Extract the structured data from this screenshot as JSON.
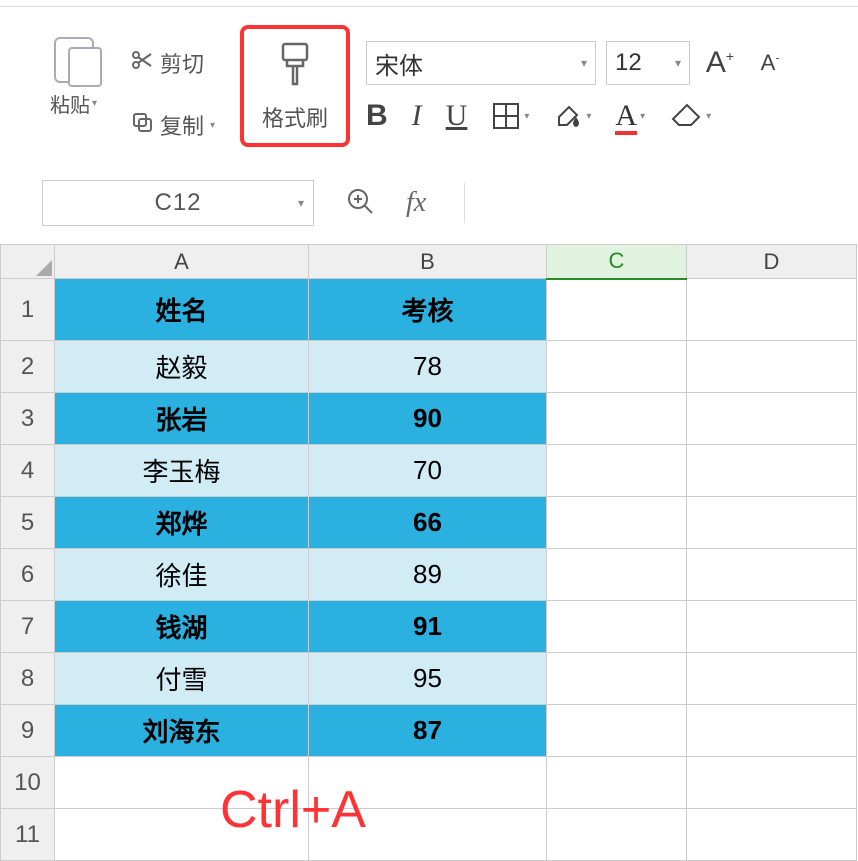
{
  "ribbon": {
    "paste_label": "粘贴",
    "cut_label": "剪切",
    "copy_label": "复制",
    "format_brush_label": "格式刷",
    "font_name": "宋体",
    "font_size": "12",
    "font_grow_glyph": "A⁺",
    "font_shrink_glyph": "A⁻",
    "bold_glyph": "B",
    "italic_glyph": "I",
    "underline_glyph": "U",
    "font_color_glyph": "A"
  },
  "formula_bar": {
    "cell_ref": "C12",
    "fx_label": "fx"
  },
  "columns": [
    "A",
    "B",
    "C",
    "D"
  ],
  "row_labels": [
    "1",
    "2",
    "3",
    "4",
    "5",
    "6",
    "7",
    "8",
    "9",
    "10",
    "11"
  ],
  "active_column": "C",
  "sheet": {
    "header": {
      "a": "姓名",
      "b": "考核"
    },
    "rows": [
      {
        "a": "赵毅",
        "b": "78",
        "style": "lite"
      },
      {
        "a": "张岩",
        "b": "90",
        "style": "blue"
      },
      {
        "a": "李玉梅",
        "b": "70",
        "style": "lite"
      },
      {
        "a": "郑烨",
        "b": "66",
        "style": "blue"
      },
      {
        "a": "徐佳",
        "b": "89",
        "style": "lite"
      },
      {
        "a": "钱湖",
        "b": "91",
        "style": "blue"
      },
      {
        "a": "付雪",
        "b": "95",
        "style": "lite"
      },
      {
        "a": "刘海东",
        "b": "87",
        "style": "blue"
      }
    ]
  },
  "annotation": "Ctrl+A"
}
